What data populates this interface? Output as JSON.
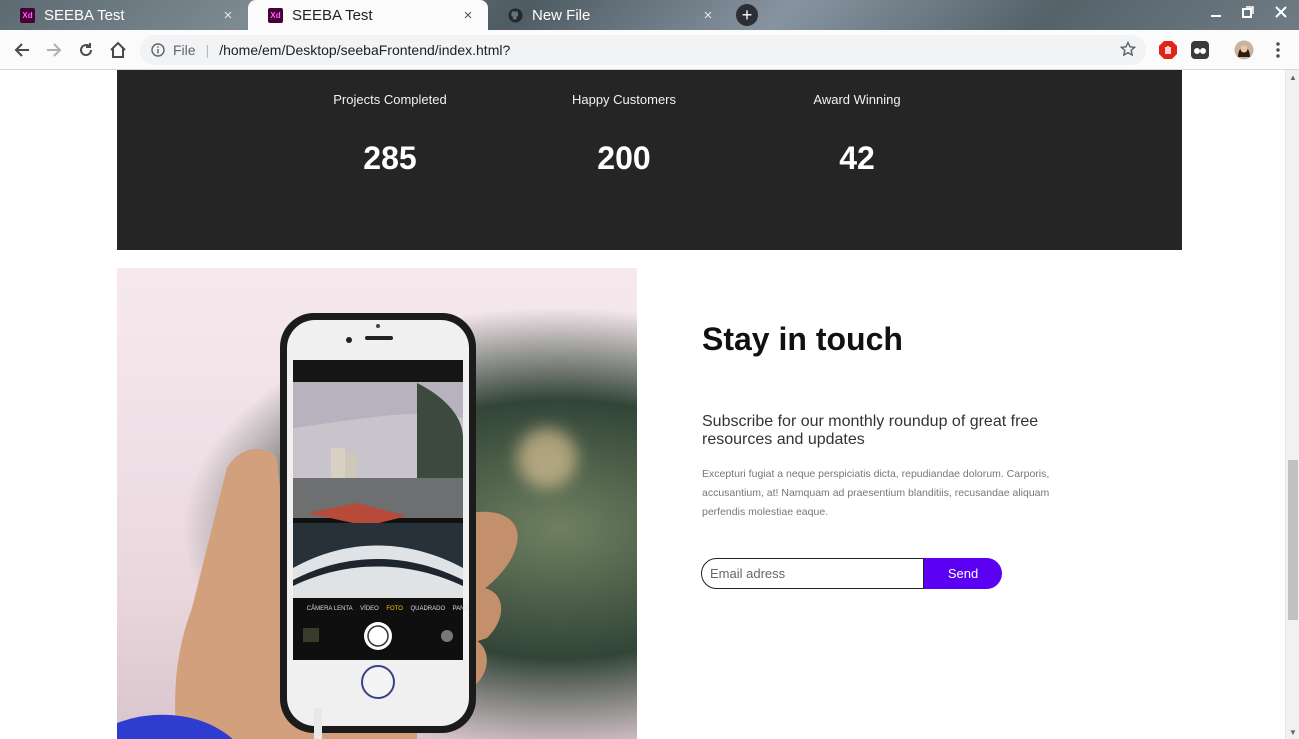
{
  "browser": {
    "tabs": [
      {
        "title": "SEEBA Test",
        "icon": "xd-icon",
        "close": "×"
      },
      {
        "title": "SEEBA Test",
        "icon": "xd-icon",
        "close": "×"
      },
      {
        "title": "New File",
        "icon": "github-icon",
        "close": "×"
      }
    ],
    "new_tab": "+",
    "address": {
      "scheme": "File",
      "separator": "|",
      "url": "/home/em/Desktop/seebaFrontend/index.html?"
    },
    "favicon_text": "Xd"
  },
  "stats": [
    {
      "label": "Projects Completed",
      "value": "285"
    },
    {
      "label": "Happy Customers",
      "value": "200"
    },
    {
      "label": "Award Winning",
      "value": "42"
    }
  ],
  "contact": {
    "title": "Stay in touch",
    "subtitle": "Subscribe for our monthly roundup of great free resources and updates",
    "body": "Excepturi fugiat a neque perspiciatis dicta, repudiandae dolorum. Carporis, accusantium, at! Namquam ad praesentium blanditiis, recusandae aliquam perfendis molestiae eaque.",
    "email_placeholder": "Email adress",
    "send_label": "Send"
  },
  "photo": {
    "camera_modes": [
      "CÂMERA LENTA",
      "VÍDEO",
      "FOTO",
      "QUADRADO",
      "PANO"
    ],
    "highlight_color": "#f5d000"
  },
  "colors": {
    "accent": "#5b00f2",
    "dark_band": "#252525"
  }
}
